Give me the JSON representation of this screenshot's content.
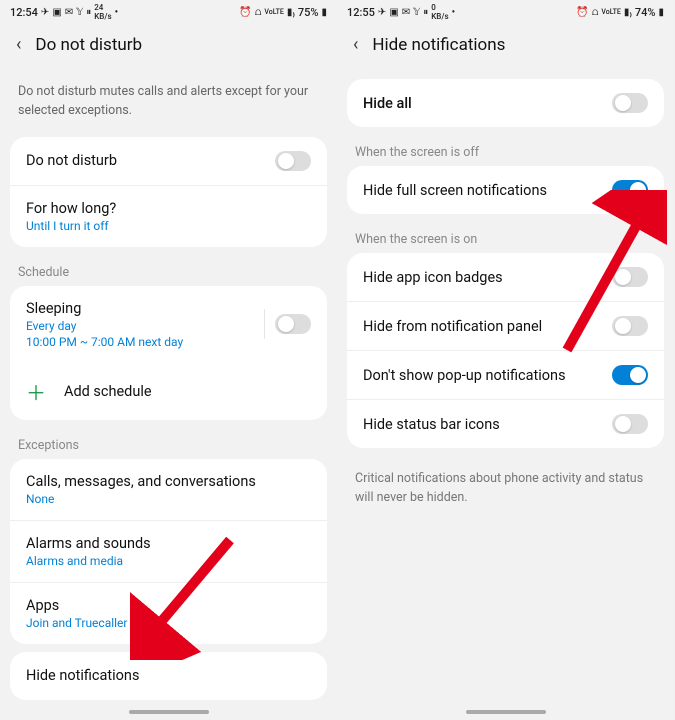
{
  "left": {
    "status": {
      "time": "12:54",
      "battery": "75%"
    },
    "title": "Do not disturb",
    "description": "Do not disturb mutes calls and alerts except for your selected exceptions.",
    "dnd_label": "Do not disturb",
    "howlong_label": "For how long?",
    "howlong_sub": "Until I turn it off",
    "schedule_header": "Schedule",
    "sleeping_label": "Sleeping",
    "sleeping_sub1": "Every day",
    "sleeping_sub2": "10:00 PM ~ 7:00 AM next day",
    "add_schedule": "Add schedule",
    "exceptions_header": "Exceptions",
    "calls_label": "Calls, messages, and conversations",
    "calls_sub": "None",
    "alarms_label": "Alarms and sounds",
    "alarms_sub": "Alarms and media",
    "apps_label": "Apps",
    "apps_sub": "Join and Truecaller",
    "hide_label": "Hide notifications"
  },
  "right": {
    "status": {
      "time": "12:55",
      "battery": "74%"
    },
    "title": "Hide notifications",
    "hide_all": "Hide all",
    "screen_off_header": "When the screen is off",
    "fullscreen_label": "Hide full screen notifications",
    "screen_on_header": "When the screen is on",
    "badges_label": "Hide app icon badges",
    "panel_label": "Hide from notification panel",
    "popup_label": "Don't show pop-up notifications",
    "statusbar_label": "Hide status bar icons",
    "footer": "Critical notifications about phone activity and status will never be hidden."
  }
}
